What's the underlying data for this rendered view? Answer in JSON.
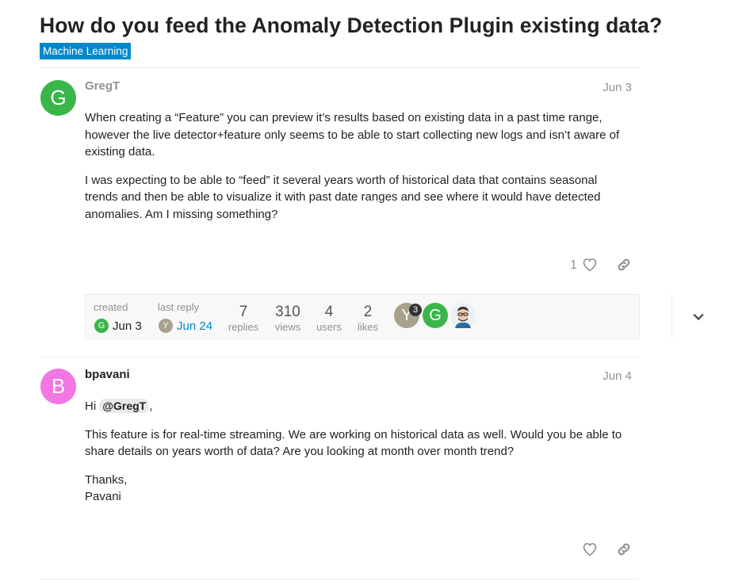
{
  "topic": {
    "title": "How do you feed the Anomaly Detection Plugin existing data?",
    "category": "Machine Learning",
    "colors": {
      "category": "#0088cc",
      "greg": "#3ab54a",
      "bpavani": "#f277e3",
      "y_avatar": "#a8a28d"
    }
  },
  "post1": {
    "avatar_letter": "G",
    "username": "GregT",
    "date": "Jun 3",
    "paragraphs": [
      "When creating a “Feature” you can preview it’s results based on existing data in a past time range, however the live detector+feature only seems to be able to start collecting new logs and isn’t aware of existing data.",
      "I was expecting to be able to “feed” it several years worth of historical data that contains seasonal trends and then be able to visualize it with past date ranges and see where it would have detected anomalies. Am I missing something?"
    ],
    "like_count": "1",
    "like_icon": "heart-icon",
    "share_icon": "link-icon"
  },
  "topic_map": {
    "created_label": "created",
    "created_avatar": "G",
    "created_date": "Jun 3",
    "last_reply_label": "last reply",
    "last_reply_avatar": "Y",
    "last_reply_date": "Jun 24",
    "stats": [
      {
        "value": "7",
        "label": "replies"
      },
      {
        "value": "310",
        "label": "views"
      },
      {
        "value": "4",
        "label": "users"
      },
      {
        "value": "2",
        "label": "likes"
      }
    ],
    "participants": [
      {
        "letter": "Y",
        "badge": "3"
      },
      {
        "letter": "G"
      }
    ],
    "expand_icon": "chevron-down-icon"
  },
  "post2": {
    "avatar_letter": "B",
    "username": "bpavani",
    "date": "Jun 4",
    "greeting_prefix": "Hi",
    "mention": "@GregT",
    "greeting_suffix": ",",
    "paragraph2": "This feature is for real-time streaming. We are working on historical data as well. Would you be able to share details on years worth of data? Are you looking at month over month trend?",
    "thanks": "Thanks,",
    "signature": "Pavani"
  }
}
